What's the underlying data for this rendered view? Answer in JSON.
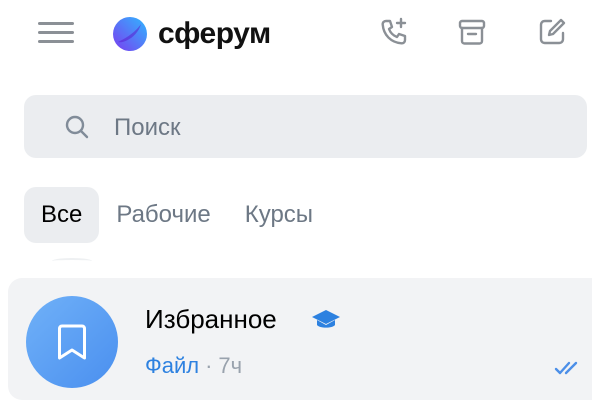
{
  "header": {
    "brand": "сферум",
    "colors": {
      "accent": "#2d81e0",
      "icon_gray": "#8b9096",
      "logo_purple": "#7b3cf0",
      "logo_blue": "#2fb8ff"
    },
    "icons": [
      "menu-icon",
      "logo-icon",
      "call-plus-icon",
      "archive-icon",
      "compose-icon"
    ]
  },
  "search": {
    "placeholder": "Поиск"
  },
  "tabs": [
    {
      "label": "Все",
      "active": true
    },
    {
      "label": "Рабочие",
      "active": false
    },
    {
      "label": "Курсы",
      "active": false
    }
  ],
  "chats": [
    {
      "title": "Избранное",
      "badge_icon": "graduation-cap-icon",
      "last_message": "Файл",
      "separator": "·",
      "time": "7ч",
      "status_icon": "double-check-icon"
    }
  ]
}
